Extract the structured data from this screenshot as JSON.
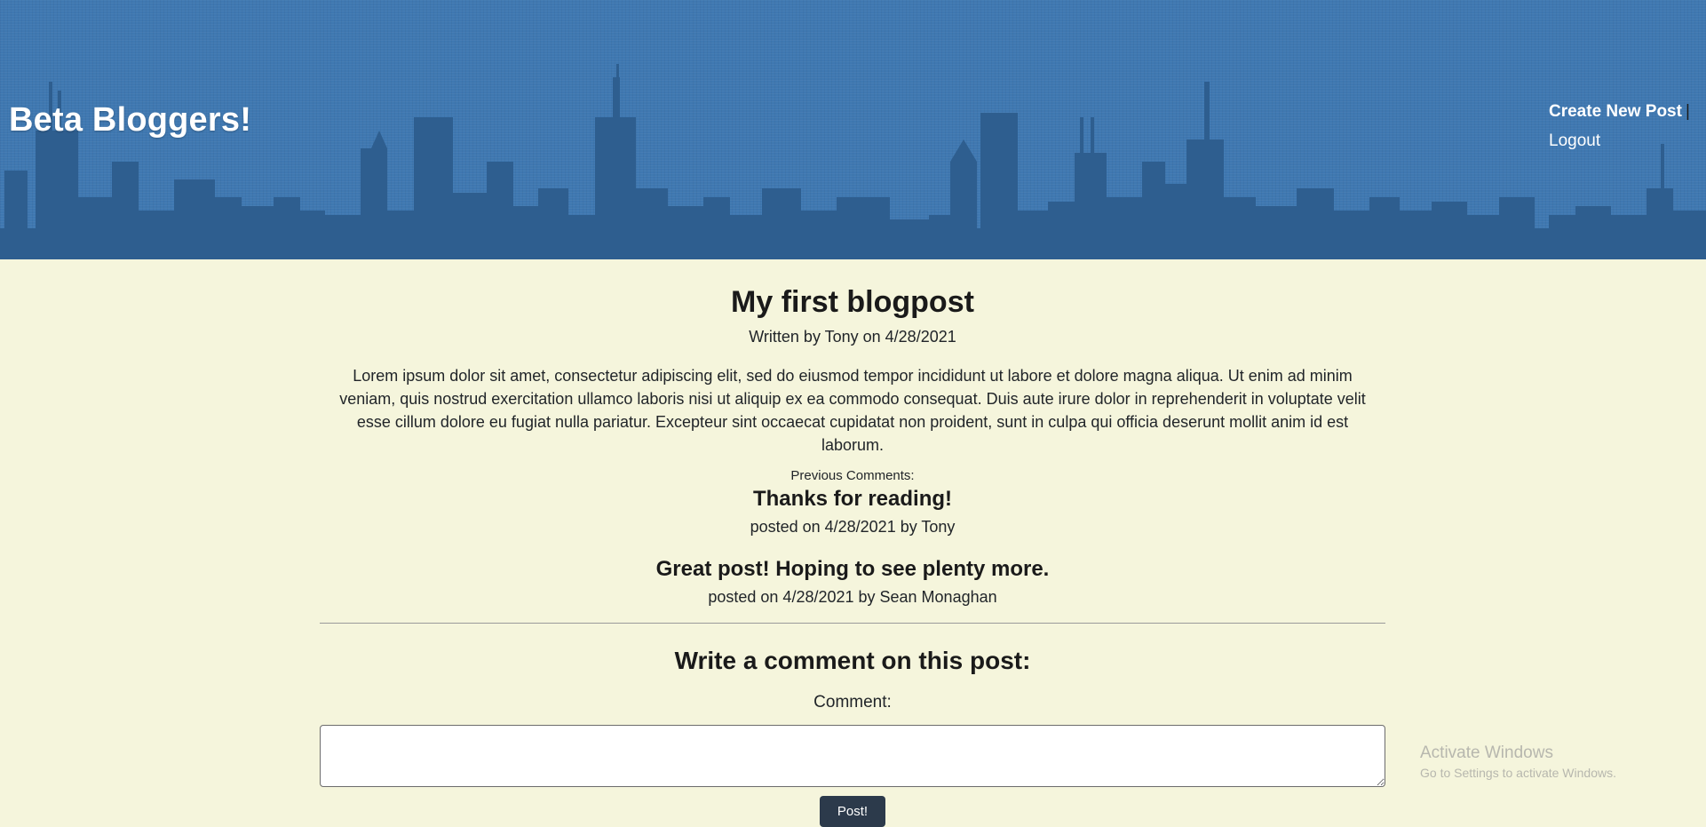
{
  "header": {
    "site_title": "Beta Bloggers!",
    "nav": {
      "create_label": "Create New Post",
      "separator": "|",
      "logout_label": "Logout"
    }
  },
  "post": {
    "title": "My first blogpost",
    "meta": "Written by Tony on 4/28/2021",
    "body": "Lorem ipsum dolor sit amet, consectetur adipiscing elit, sed do eiusmod tempor incididunt ut labore et dolore magna aliqua. Ut enim ad minim veniam, quis nostrud exercitation ullamco laboris nisi ut aliquip ex ea commodo consequat. Duis aute irure dolor in reprehenderit in voluptate velit esse cillum dolore eu fugiat nulla pariatur. Excepteur sint occaecat cupidatat non proident, sunt in culpa qui officia deserunt mollit anim id est laborum."
  },
  "comments": {
    "label": "Previous Comments:",
    "items": [
      {
        "text": "Thanks for reading!",
        "meta": "posted on 4/28/2021 by Tony"
      },
      {
        "text": "Great post! Hoping to see plenty more.",
        "meta": "posted on 4/28/2021 by Sean Monaghan"
      }
    ]
  },
  "form": {
    "title": "Write a comment on this post:",
    "label": "Comment:",
    "value": "",
    "submit_label": "Post!"
  },
  "watermark": {
    "title": "Activate Windows",
    "subtitle": "Go to Settings to activate Windows."
  },
  "colors": {
    "header_bg": "#3f78b1",
    "skyline": "#2e5e8f",
    "page_bg": "#f5f5dc",
    "button_bg": "#2c3a4b"
  }
}
